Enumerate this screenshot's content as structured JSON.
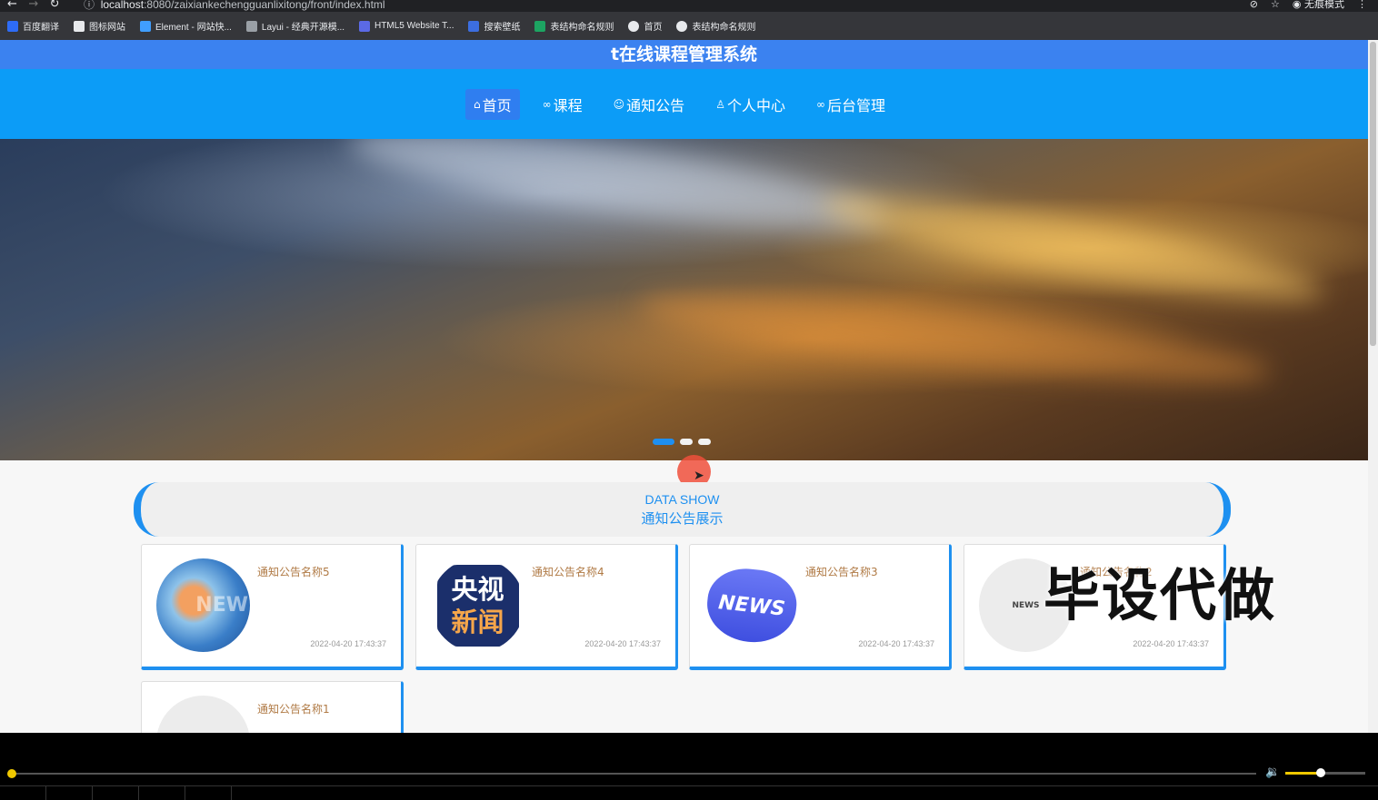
{
  "browser": {
    "url_host": "localhost",
    "url_path": ":8080/zaixiankechengguanlixitong/front/index.html",
    "profile_label": "无痕模式",
    "bookmarks": [
      {
        "label": "百度翻译",
        "color": "#2e6cf6"
      },
      {
        "label": "图标网站",
        "color": "#e8eaed"
      },
      {
        "label": "Element - 网站快...",
        "color": "#409eff"
      },
      {
        "label": "Layui - 经典开源模...",
        "color": "#9aa0a6"
      },
      {
        "label": "HTML5 Website T...",
        "color": "#5b6ae6"
      },
      {
        "label": "搜索壁纸",
        "color": "#3c6ee0"
      },
      {
        "label": "表结构命名规则",
        "color": "#1da462"
      },
      {
        "label": "首页",
        "color": "#e8eaed"
      },
      {
        "label": "表结构命名规则",
        "color": "#e8eaed"
      }
    ]
  },
  "site": {
    "title": "t在线课程管理系统",
    "nav": [
      {
        "label": "首页",
        "icon": "home-icon",
        "active": true
      },
      {
        "label": "课程",
        "icon": "link-icon",
        "active": false
      },
      {
        "label": "通知公告",
        "icon": "smile-icon",
        "active": false
      },
      {
        "label": "个人中心",
        "icon": "user-icon",
        "active": false
      },
      {
        "label": "后台管理",
        "icon": "link-icon",
        "active": false
      }
    ]
  },
  "carousel": {
    "slide_count": 3,
    "active_index": 0
  },
  "section": {
    "title_en": "DATA SHOW",
    "title_cn": "通知公告展示"
  },
  "notices": [
    {
      "name": "通知公告名称5",
      "date": "2022-04-20 17:43:37",
      "thumb": "globe-news"
    },
    {
      "name": "通知公告名称4",
      "date": "2022-04-20 17:43:37",
      "thumb": "cctv-news"
    },
    {
      "name": "通知公告名称3",
      "date": "2022-04-20 17:43:37",
      "thumb": "news-3d"
    },
    {
      "name": "通知公告名称2",
      "date": "2022-04-20 17:43:37",
      "thumb": "news-paper"
    },
    {
      "name": "通知公告名称1",
      "date": "",
      "thumb": "news-paper"
    }
  ],
  "thumb_text": {
    "globe": "NEW",
    "cctv_line1": "央视",
    "cctv_line2": "新闻",
    "news3d": "NEWS",
    "paper": "NEWS"
  },
  "watermark": "毕设代做",
  "player": {
    "progress": 0.0,
    "volume": 0.4
  }
}
